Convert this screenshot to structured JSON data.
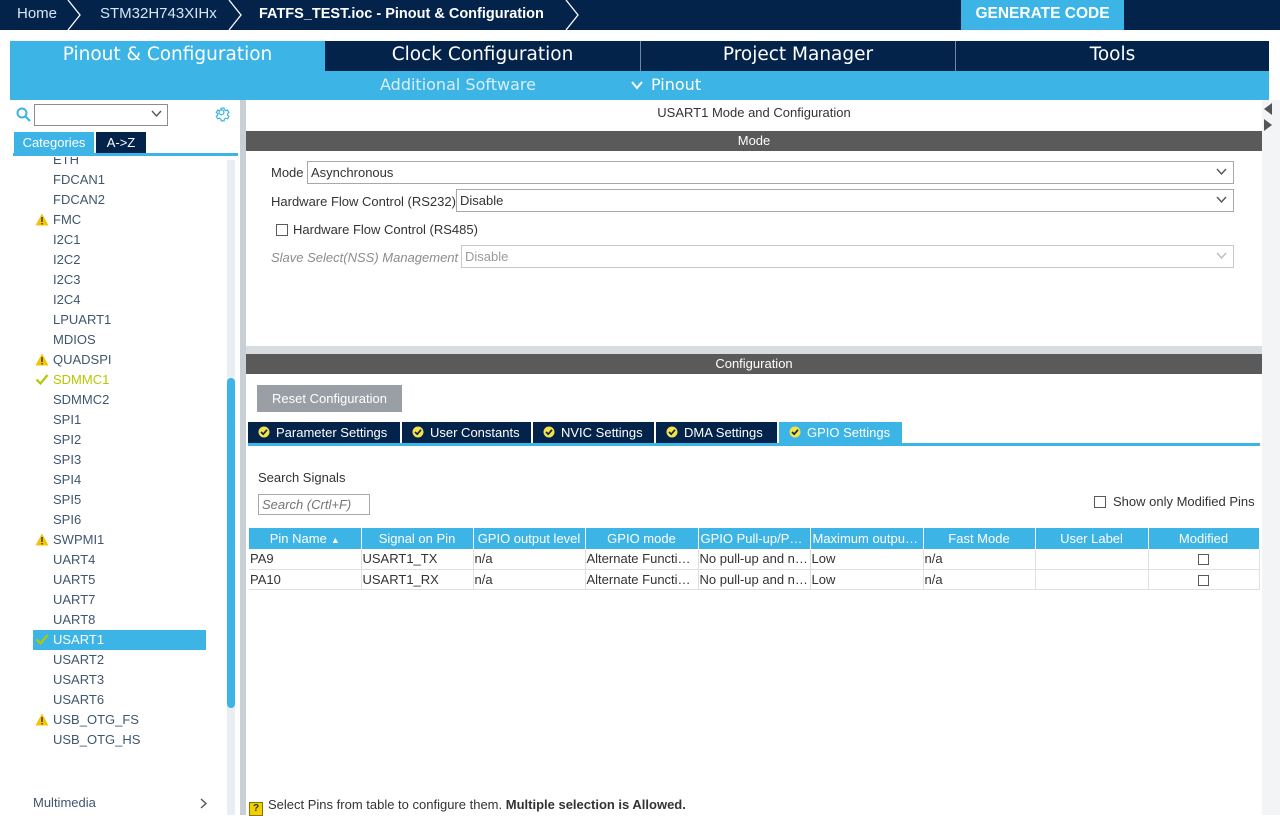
{
  "breadcrumb": {
    "home": "Home",
    "device": "STM32H743XIHx",
    "current": "FATFS_TEST.ioc - Pinout & Configuration"
  },
  "generate_code_label": "GENERATE CODE",
  "main_tabs": {
    "pinout": "Pinout & Configuration",
    "clock": "Clock Configuration",
    "project": "Project Manager",
    "tools": "Tools"
  },
  "sub_menu": {
    "additional_software": "Additional Software",
    "pinout": "Pinout"
  },
  "left": {
    "search_value": "",
    "tabs": {
      "categories": "Categories",
      "az": "A->Z"
    },
    "peripherals": [
      {
        "label": "ETH",
        "status": "none"
      },
      {
        "label": "FDCAN1",
        "status": "none"
      },
      {
        "label": "FDCAN2",
        "status": "none"
      },
      {
        "label": "FMC",
        "status": "warning"
      },
      {
        "label": "I2C1",
        "status": "none"
      },
      {
        "label": "I2C2",
        "status": "none"
      },
      {
        "label": "I2C3",
        "status": "none"
      },
      {
        "label": "I2C4",
        "status": "none"
      },
      {
        "label": "LPUART1",
        "status": "none"
      },
      {
        "label": "MDIOS",
        "status": "none"
      },
      {
        "label": "QUADSPI",
        "status": "warning"
      },
      {
        "label": "SDMMC1",
        "status": "ok"
      },
      {
        "label": "SDMMC2",
        "status": "none"
      },
      {
        "label": "SPI1",
        "status": "none"
      },
      {
        "label": "SPI2",
        "status": "none"
      },
      {
        "label": "SPI3",
        "status": "none"
      },
      {
        "label": "SPI4",
        "status": "none"
      },
      {
        "label": "SPI5",
        "status": "none"
      },
      {
        "label": "SPI6",
        "status": "none"
      },
      {
        "label": "SWPMI1",
        "status": "warning"
      },
      {
        "label": "UART4",
        "status": "none"
      },
      {
        "label": "UART5",
        "status": "none"
      },
      {
        "label": "UART7",
        "status": "none"
      },
      {
        "label": "UART8",
        "status": "none"
      },
      {
        "label": "USART1",
        "status": "selected"
      },
      {
        "label": "USART2",
        "status": "none"
      },
      {
        "label": "USART3",
        "status": "none"
      },
      {
        "label": "USART6",
        "status": "none"
      },
      {
        "label": "USB_OTG_FS",
        "status": "warning"
      },
      {
        "label": "USB_OTG_HS",
        "status": "none"
      }
    ],
    "multimedia": "Multimedia"
  },
  "panel": {
    "title": "USART1 Mode and Configuration",
    "mode_header": "Mode",
    "mode_label": "Mode",
    "mode_value": "Asynchronous",
    "hw_flow_label": "Hardware Flow Control (RS232)",
    "hw_flow_value": "Disable",
    "hw_flow_rs485_label": "Hardware Flow Control (RS485)",
    "hw_flow_rs485_checked": false,
    "slave_select_label": "Slave Select(NSS) Management",
    "slave_select_value": "Disable",
    "config_header": "Configuration",
    "reset_label": "Reset Configuration",
    "config_tabs": {
      "parameter": "Parameter Settings",
      "user_constants": "User Constants",
      "nvic": "NVIC Settings",
      "dma": "DMA Settings",
      "gpio": "GPIO Settings"
    },
    "active_tab": "gpio",
    "search_signals_label": "Search Signals",
    "search_signals_placeholder": "Search (Crtl+F)",
    "show_modified_label": "Show only Modified Pins",
    "show_modified_checked": false,
    "table_headers": {
      "pin_name": "Pin Name",
      "signal": "Signal on Pin",
      "output_level": "GPIO output level",
      "mode": "GPIO mode",
      "pull": "GPIO Pull-up/Pull-down",
      "max_speed": "Maximum output speed",
      "fast_mode": "Fast Mode",
      "user_label": "User Label",
      "modified": "Modified"
    },
    "rows": [
      {
        "pin": "PA9",
        "signal": "USART1_TX",
        "output_level": "n/a",
        "mode": "Alternate Function Push Pull",
        "pull": "No pull-up and no pull-down",
        "speed": "Low",
        "fast": "n/a",
        "user_label": "",
        "modified": false
      },
      {
        "pin": "PA10",
        "signal": "USART1_RX",
        "output_level": "n/a",
        "mode": "Alternate Function Push Pull",
        "pull": "No pull-up and no pull-down",
        "speed": "Low",
        "fast": "n/a",
        "user_label": "",
        "modified": false
      }
    ],
    "hint_text": "Select Pins from table to configure them.",
    "hint_bold": "Multiple selection is Allowed."
  },
  "colors": {
    "navy": "#03234b",
    "accent": "#3cb4e6",
    "warning": "#f5c400",
    "ok": "#b6c800"
  }
}
